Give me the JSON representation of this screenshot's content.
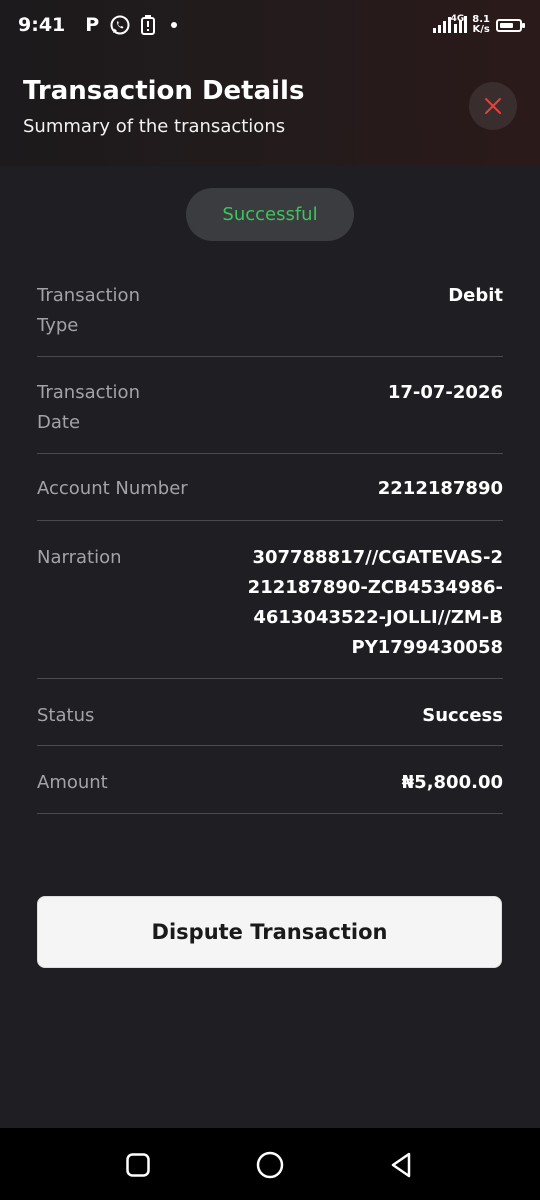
{
  "status_bar": {
    "time": "9:41",
    "p_label": "P",
    "network": "4G",
    "speed_value": "8.1",
    "speed_unit": "K/s"
  },
  "header": {
    "title": "Transaction Details",
    "subtitle": "Summary of  the transactions"
  },
  "status_pill": "Successful",
  "details": [
    {
      "label": "Transaction Type",
      "value": "Debit"
    },
    {
      "label": "Transaction Date",
      "value": "17-07-2026"
    },
    {
      "label": "Account Number",
      "value": "2212187890"
    },
    {
      "label": "Narration",
      "value": "307788817//CGATEVAS-2212187890-ZCB4534986-4613043522-JOLLI//ZM-BPY1799430058"
    },
    {
      "label": "Status",
      "value": "Success"
    },
    {
      "label": "Amount",
      "value": "₦5,800.00"
    }
  ],
  "dispute_label": "Dispute Transaction",
  "colors": {
    "background": "#1f1f23",
    "success_green": "#3ec35e",
    "close_red": "#e2433c",
    "button_bg": "#f5f5f5"
  },
  "icons": [
    "whatsapp-icon",
    "battery-saver-icon",
    "signal-icon",
    "battery-icon",
    "close-icon",
    "nav-recent-icon",
    "nav-home-icon",
    "nav-back-icon"
  ]
}
